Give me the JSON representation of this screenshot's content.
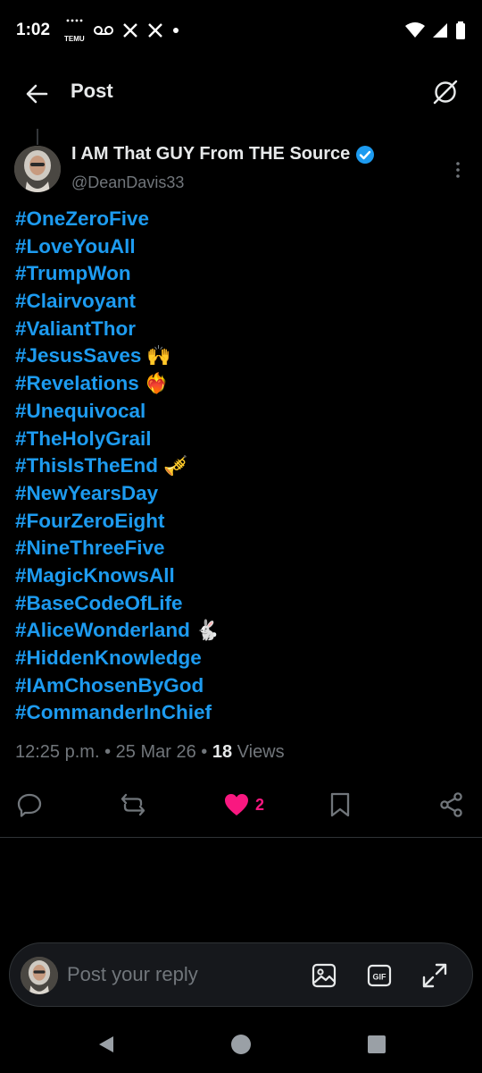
{
  "status_bar": {
    "time": "1:02",
    "temu_label": "TEMU",
    "icons": [
      "temu-icon",
      "voicemail-icon",
      "x-icon",
      "x-icon",
      "dot-icon",
      "wifi-icon",
      "signal-icon",
      "battery-icon"
    ]
  },
  "header": {
    "title": "Post",
    "back_icon": "arrow-left-icon",
    "grok_icon": "grok-icon"
  },
  "post": {
    "author_name": "I AM That GUY From THE Source",
    "verified": true,
    "handle": "@DeanDavis33",
    "tags": [
      {
        "text": "#OneZeroFive",
        "emoji": ""
      },
      {
        "text": "#LoveYouAll",
        "emoji": ""
      },
      {
        "text": "#TrumpWon",
        "emoji": ""
      },
      {
        "text": "#Clairvoyant",
        "emoji": ""
      },
      {
        "text": "#ValiantThor",
        "emoji": ""
      },
      {
        "text": "#JesusSaves",
        "emoji": "🙌"
      },
      {
        "text": "#Revelations",
        "emoji": "❤️‍🔥"
      },
      {
        "text": "#Unequivocal",
        "emoji": ""
      },
      {
        "text": "#TheHolyGrail",
        "emoji": ""
      },
      {
        "text": "#ThisIsTheEnd",
        "emoji": "🎺"
      },
      {
        "text": "#NewYearsDay",
        "emoji": ""
      },
      {
        "text": "#FourZeroEight",
        "emoji": ""
      },
      {
        "text": "#NineThreeFive",
        "emoji": ""
      },
      {
        "text": "#MagicKnowsAll",
        "emoji": ""
      },
      {
        "text": "#BaseCodeOfLife",
        "emoji": ""
      },
      {
        "text": "#AliceWonderland",
        "emoji": "🐇"
      },
      {
        "text": "#HiddenKnowledge",
        "emoji": ""
      },
      {
        "text": "#IAmChosenByGod",
        "emoji": ""
      },
      {
        "text": "#CommanderInChief",
        "emoji": ""
      }
    ],
    "time": "12:25 p.m.",
    "date": "25 Mar 26",
    "views_count": "18",
    "views_label": "Views"
  },
  "actions": {
    "reply_icon": "comment-icon",
    "repost_icon": "repost-icon",
    "like_icon": "heart-filled-icon",
    "like_count": "2",
    "bookmark_icon": "bookmark-icon",
    "share_icon": "share-icon"
  },
  "reply_bar": {
    "placeholder": "Post your reply",
    "icons": [
      "image-icon",
      "gif-icon",
      "expand-icon"
    ]
  },
  "colors": {
    "background": "#000000",
    "link": "#1d9bf0",
    "muted": "#71767b",
    "like": "#f91880",
    "text": "#e7e9ea"
  }
}
